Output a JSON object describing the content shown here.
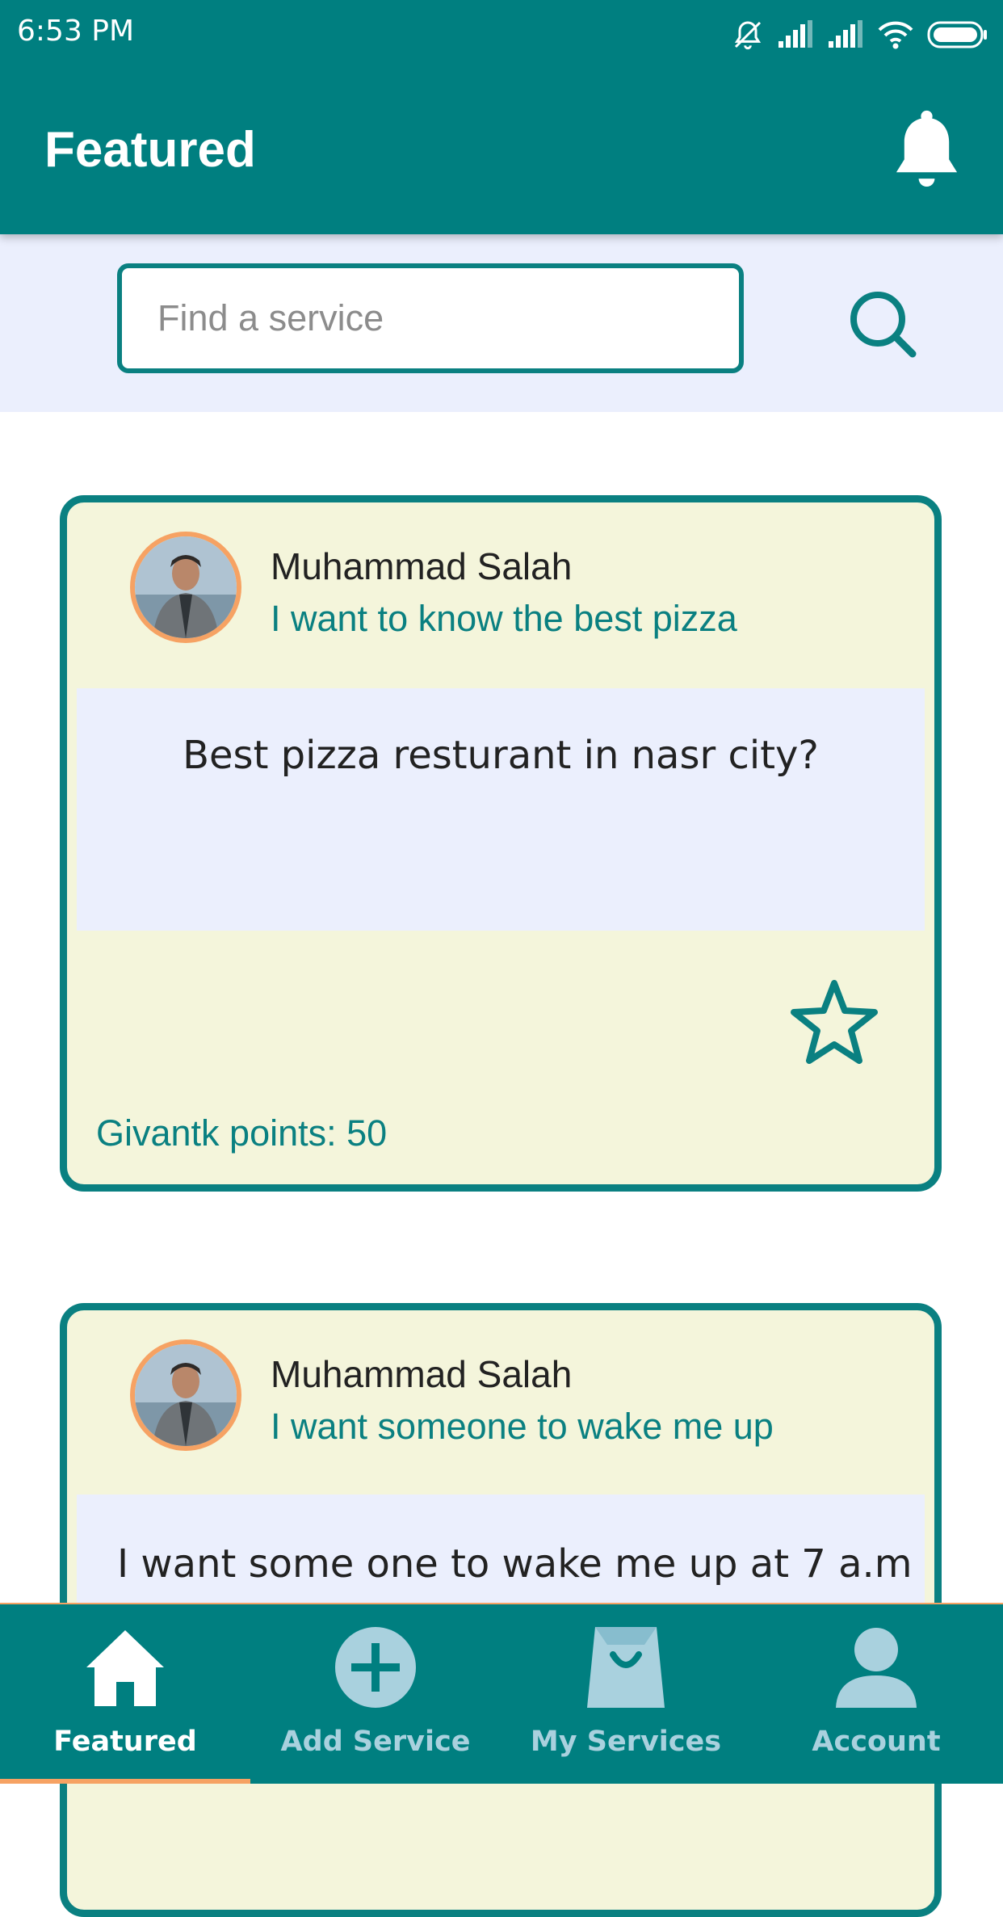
{
  "status_bar": {
    "time": "6:53 PM",
    "icons": [
      "bell-muted-icon",
      "signal-icon",
      "signal-icon",
      "wifi-icon",
      "battery-icon"
    ]
  },
  "header": {
    "title": "Featured",
    "notification_icon": "bell-icon"
  },
  "search": {
    "placeholder": "Find a service",
    "value": "",
    "button_icon": "search-icon"
  },
  "cards": [
    {
      "user_name": "Muhammad Salah",
      "title": "I want to know the best pizza",
      "body": "Best pizza resturant in nasr city?",
      "points_text": "Givantk points: 50",
      "favorite_icon": "star-outline-icon"
    },
    {
      "user_name": "Muhammad Salah",
      "title": "I want someone to wake me up",
      "body": "I want some one to wake me up at 7 a.m"
    }
  ],
  "bottom_nav": {
    "items": [
      {
        "label": "Featured",
        "icon": "home-icon",
        "active": true
      },
      {
        "label": "Add Service",
        "icon": "plus-circle-icon",
        "active": false
      },
      {
        "label": "My Services",
        "icon": "shopping-bag-icon",
        "active": false
      },
      {
        "label": "Account",
        "icon": "person-icon",
        "active": false
      }
    ]
  },
  "colors": {
    "primary": "#007F80",
    "accent": "#F6A263",
    "card_background": "#F4F5DB",
    "card_body_background": "#EBEFFD",
    "inactive_nav": "#A9D1DE"
  }
}
